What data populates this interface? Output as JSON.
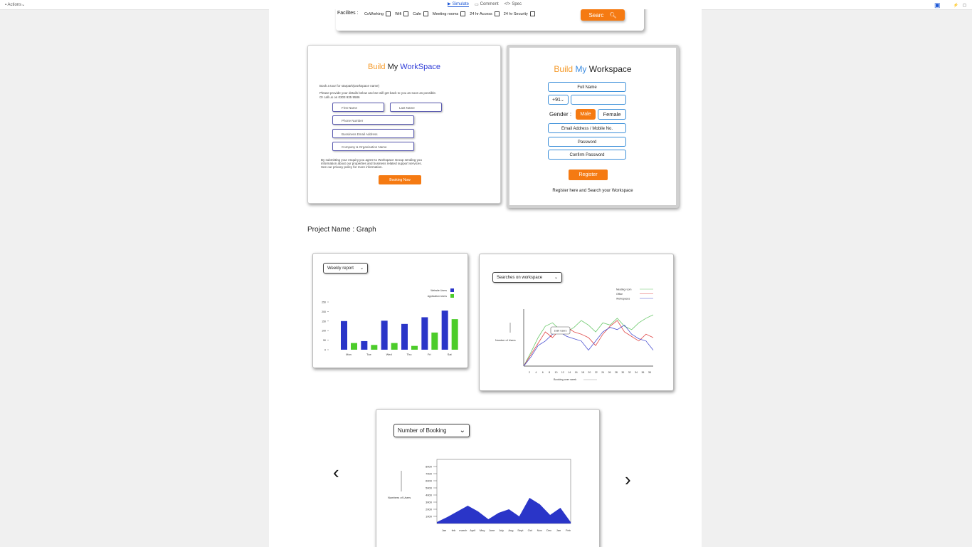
{
  "topbar": {
    "actions": "Actions",
    "simulate": "Simulate",
    "comment": "Comment",
    "spec": "Spec"
  },
  "filter": {
    "label": "Facilites :",
    "items": [
      "CoWorking",
      "Wifi",
      "Cafe",
      "Meeting rooms",
      "24 hr Access",
      "24 hr Security"
    ],
    "search_label": "Searc"
  },
  "form1": {
    "brand": [
      "Build",
      "My",
      "WorkSpace"
    ],
    "intro1": "Book a tour for starpark(workspace name)",
    "intro2": "Please provide your details below and we will get back to you as soon as possible.",
    "intro3": "Or call us on 0303 935 9586",
    "first_name": "First Name",
    "last_name": "Last Name",
    "phone": "Phone Number",
    "email": "Bussiness Email Address",
    "company": "Company & Organisation Name",
    "disclaimer1": "By submitting your enquiry,you agree to Workspace Group sending you",
    "disclaimer2": "information about our properties and business related support services.",
    "disclaimer3": "See our privacy policy for more information.",
    "button": "Booking Now"
  },
  "form2": {
    "brand": [
      "Build",
      "My",
      "Workspace"
    ],
    "full_name": "Full Name",
    "country_code": "+91",
    "gender_label": "Gender :",
    "male": "Male",
    "female": "Female",
    "email_mobile": "Email Address / Mobile No.",
    "password": "Password",
    "confirm_password": "Confirm Password",
    "register": "Register",
    "footer": "Register here  and Search your Workspace"
  },
  "project": {
    "label": "Project Name  :",
    "name": "Graph"
  },
  "nav": {
    "prev": "‹",
    "next": "›"
  },
  "chart_data": [
    {
      "type": "bar",
      "dropdown": "Weekly report",
      "categories": [
        "Mon",
        "Tue",
        "Wed",
        "Thu",
        "Fri",
        "Sat"
      ],
      "series": [
        {
          "name": "Website Users",
          "color": "#2a35c8",
          "values": [
            150,
            45,
            152,
            135,
            170,
            205
          ]
        },
        {
          "name": "Application Users",
          "color": "#4ccc2a",
          "values": [
            35,
            25,
            35,
            20,
            90,
            160
          ]
        }
      ],
      "yticks": [
        "0",
        "50",
        "100",
        "150",
        "200",
        "250"
      ],
      "ylim": [
        0,
        250
      ]
    },
    {
      "type": "line",
      "dropdown": "Searches on workspace",
      "ylabel": "Number of Users",
      "xlabel": "Booking over week",
      "annotation": "1k30 Users",
      "x": [
        "2",
        "4",
        "6",
        "8",
        "10",
        "12",
        "14",
        "16",
        "18",
        "20",
        "22",
        "24",
        "26",
        "28",
        "30",
        "32",
        "34",
        "36",
        "38"
      ],
      "series": [
        {
          "name": "Meeting room",
          "color": "#6ac86a",
          "values": [
            0,
            12,
            25,
            35,
            38,
            32,
            30,
            34,
            40,
            36,
            30,
            38,
            36,
            42,
            35,
            32,
            38,
            42,
            45
          ]
        },
        {
          "name": "Office",
          "color": "#e04848",
          "values": [
            0,
            10,
            20,
            30,
            25,
            32,
            34,
            30,
            28,
            25,
            18,
            28,
            35,
            40,
            30,
            26,
            22,
            28,
            25
          ]
        },
        {
          "name": "Workspaces",
          "color": "#4a50d0",
          "values": [
            0,
            8,
            18,
            22,
            28,
            30,
            26,
            24,
            22,
            14,
            22,
            30,
            34,
            32,
            36,
            28,
            24,
            22,
            14
          ]
        }
      ]
    },
    {
      "type": "area",
      "dropdown": "Number of Booking",
      "ylabel": "Numbers of Users",
      "categories": [
        "Jan",
        "feb",
        "march",
        "April",
        "May",
        "June",
        "July",
        "Aug",
        "Sept",
        "Oct",
        "Nov",
        "Dec",
        "Jan",
        "Feb"
      ],
      "yticks": [
        "1000",
        "2000",
        "3000",
        "4000",
        "5000",
        "6000",
        "7000",
        "8000"
      ],
      "ylim": [
        0,
        9000
      ],
      "color": "#2a35c8",
      "values": [
        200,
        900,
        1700,
        2500,
        1700,
        600,
        1500,
        2000,
        1000,
        3600,
        2700,
        1200,
        2200,
        200
      ]
    }
  ]
}
